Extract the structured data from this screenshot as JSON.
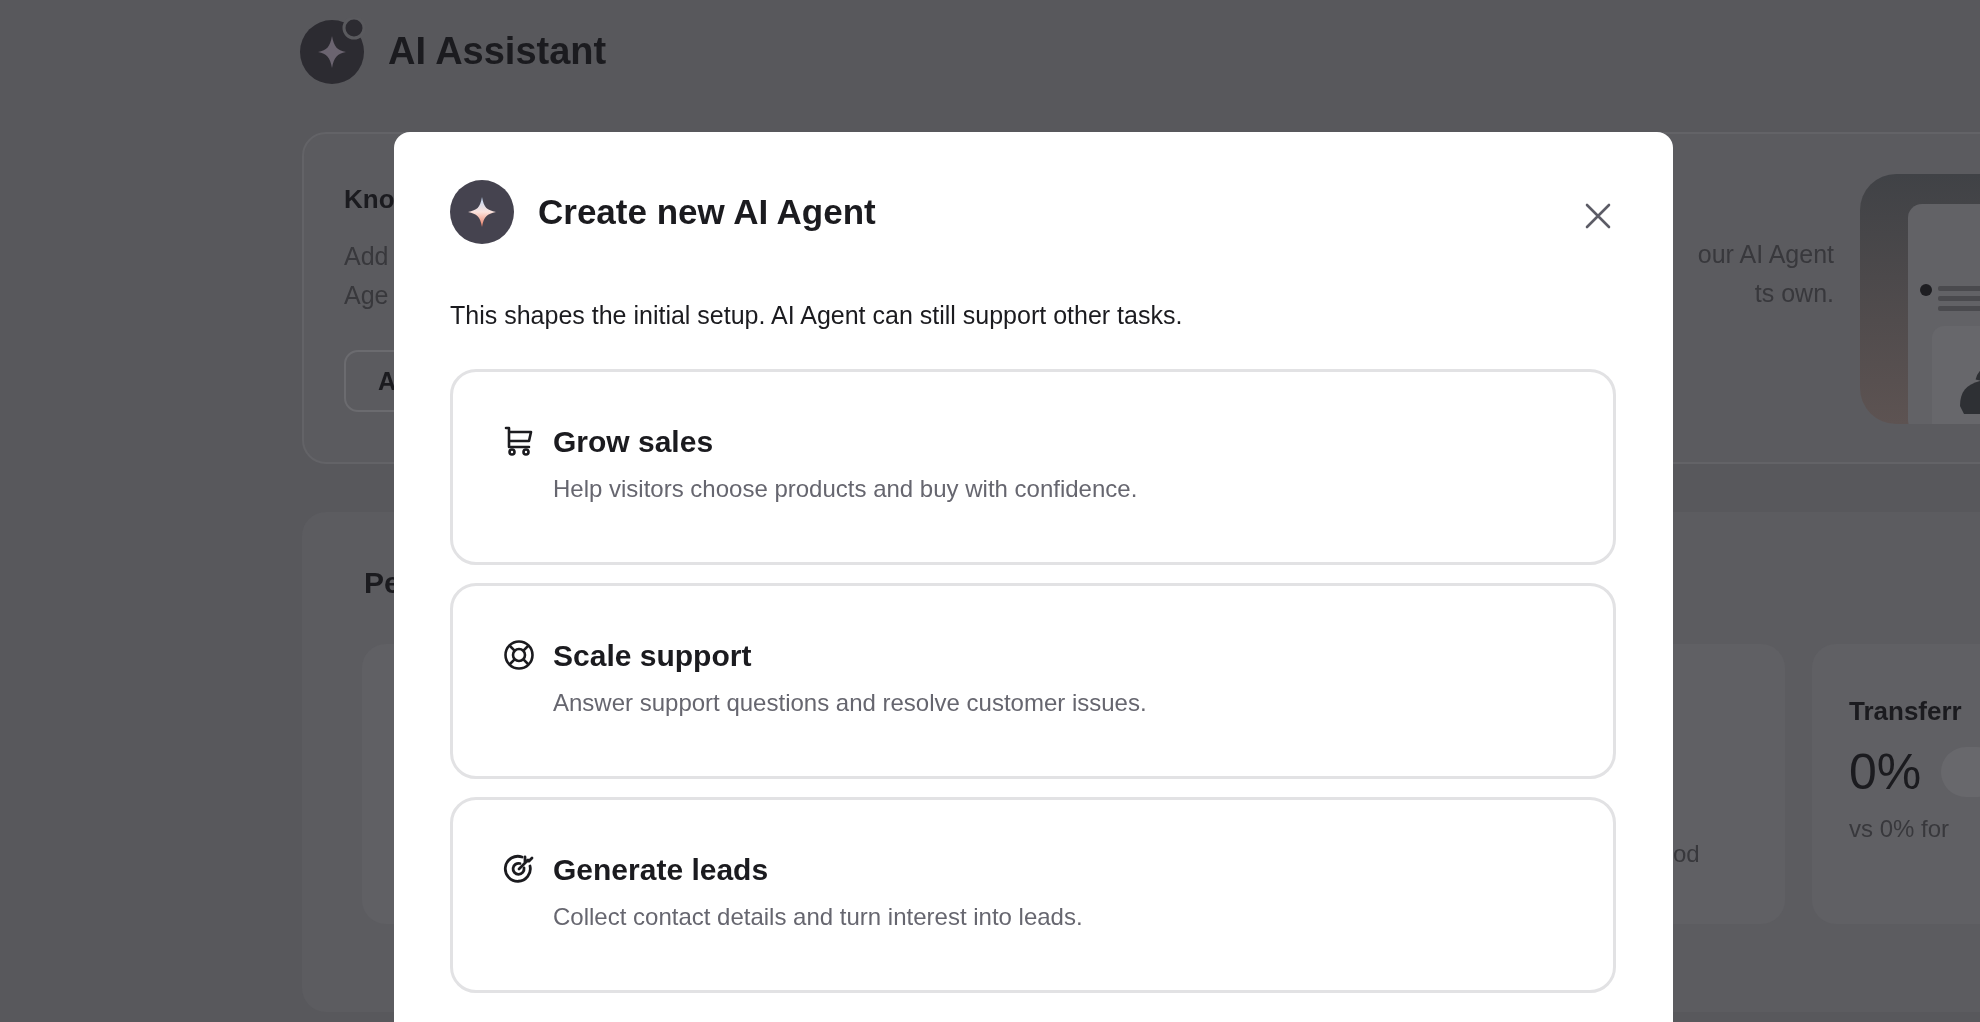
{
  "page_header": {
    "title": "AI Assistant"
  },
  "knowledge_card": {
    "title": "Kno",
    "description_lines": [
      "Add",
      "Age"
    ],
    "button": "A",
    "description_right_lines": [
      "our AI Agent",
      "ts own."
    ],
    "kind": "picture"
  },
  "performance_card": {
    "title": "Pe",
    "period_caption": "od",
    "transfer_card": {
      "title": "Transferr",
      "value": "0%",
      "comparison": "vs 0% for"
    }
  },
  "modal": {
    "title": "Create new AI Agent",
    "subtitle": "This shapes the initial setup. AI Agent can still support other tasks.",
    "options": [
      {
        "kind": "cart",
        "title": "Grow sales",
        "description": "Help visitors choose products and buy with confidence.",
        "selected": false
      },
      {
        "kind": "lifebuoy",
        "title": "Scale support",
        "description": "Answer support questions and resolve customer issues.",
        "selected": false
      },
      {
        "kind": "target",
        "title": "Generate leads",
        "description": "Collect contact details and turn interest into leads.",
        "selected": false
      }
    ]
  }
}
